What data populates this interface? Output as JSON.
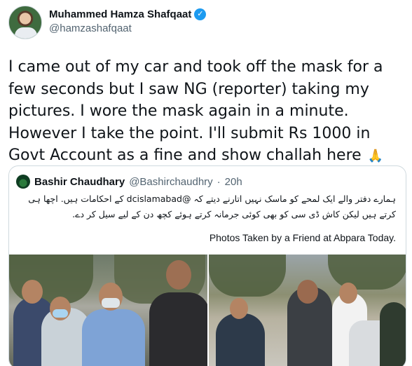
{
  "author": {
    "display_name": "Muhammed Hamza Shafqaat",
    "handle": "@hamzashafqaat",
    "verified_icon": "verified-badge-icon"
  },
  "tweet": {
    "text": "I came out of my car and took off the mask for a few seconds but I saw NG (reporter) taking my pictures. I wore the mask again in a minute. However I take the point. I'll submit Rs 1000 in Govt Account as a fine and show challah here",
    "emoji": "🙏"
  },
  "quoted": {
    "display_name": "Bashir Chaudhary",
    "handle": "@Bashirchaudhry",
    "separator": "·",
    "time": "20h",
    "urdu_text": "ہمارے دفتر والے ایک لمحے کو ماسک نہیں اتارنے دیتے کہ @dcislamabad کے احکامات ہیں. اچھا ہی کرتے ہیں لیکن کاش ڈی سی کو بھی کوئی جرمانہ کرتے ہوئے کچھ دن کے لیے سیل کر دے.",
    "english_text": "Photos Taken by a Friend at Abpara Today."
  },
  "colors": {
    "accent": "#1d9bf0",
    "text": "#0f1419",
    "secondary": "#536471",
    "border": "#cfd9de"
  }
}
